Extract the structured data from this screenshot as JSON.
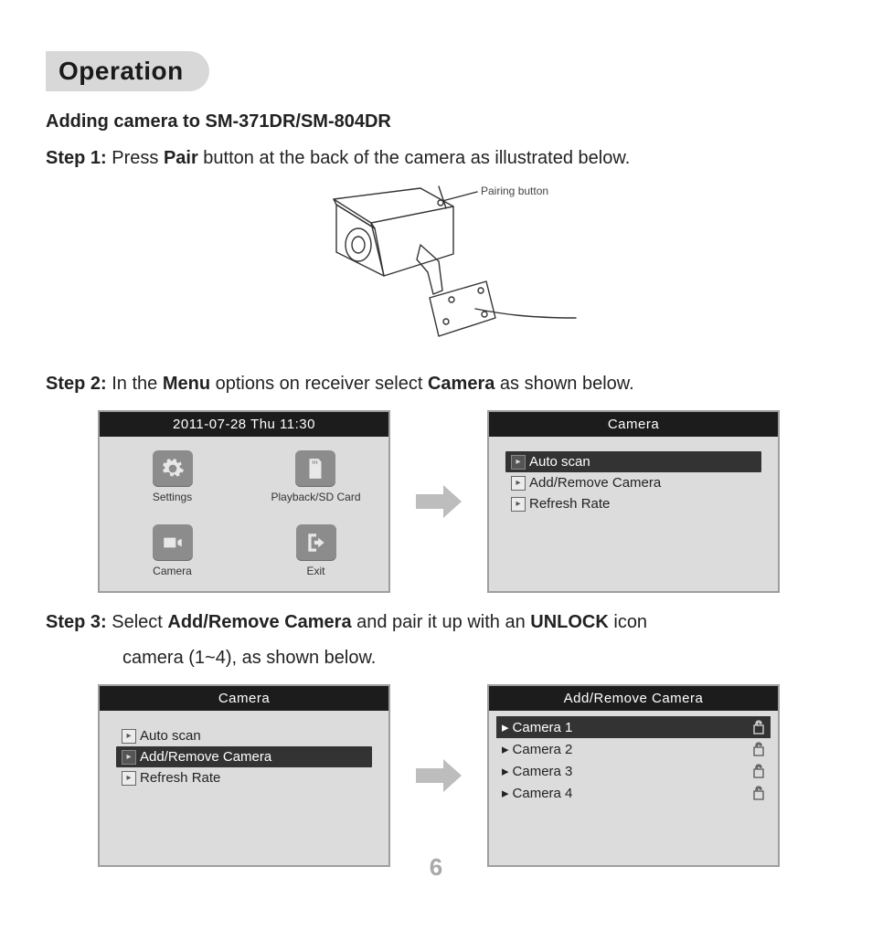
{
  "section_title": "Operation",
  "sub_heading": "Adding camera to SM-371DR/SM-804DR",
  "step1": {
    "label": "Step 1:",
    "pre": " Press ",
    "b1": "Pair",
    "post": " button at the back of the camera as illustrated below."
  },
  "cam_illustration": {
    "callout": "Pairing button"
  },
  "step2": {
    "label": "Step 2:",
    "pre": " In the ",
    "b1": "Menu",
    "mid": " options on receiver select ",
    "b2": "Camera",
    "post": " as shown below."
  },
  "screen_menu": {
    "header": "2011-07-28 Thu  11:30",
    "items": [
      {
        "label": "Settings",
        "icon": "gear"
      },
      {
        "label": "Playback/SD Card",
        "icon": "sd"
      },
      {
        "label": "Camera",
        "icon": "camera"
      },
      {
        "label": "Exit",
        "icon": "exit"
      }
    ]
  },
  "screen_camera_menu1": {
    "header": "Camera",
    "items": [
      {
        "label": "Auto scan",
        "selected": true
      },
      {
        "label": "Add/Remove  Camera",
        "selected": false
      },
      {
        "label": "Refresh Rate",
        "selected": false
      }
    ]
  },
  "step3": {
    "label": "Step 3:",
    "pre": " Select ",
    "b1": "Add/Remove Camera",
    "mid": " and pair it up with an ",
    "b2": "UNLOCK",
    "post": " icon",
    "line2": "camera (1~4), as shown below."
  },
  "screen_camera_menu2": {
    "header": "Camera",
    "items": [
      {
        "label": "Auto scan",
        "selected": false
      },
      {
        "label": "Add/Remove  Camera",
        "selected": true
      },
      {
        "label": "Refresh Rate",
        "selected": false
      }
    ]
  },
  "screen_add_remove": {
    "header": "Add/Remove Camera",
    "items": [
      {
        "label": "Camera 1",
        "selected": true,
        "lock": "unlock"
      },
      {
        "label": "Camera 2",
        "selected": false,
        "lock": "unlock"
      },
      {
        "label": "Camera 3",
        "selected": false,
        "lock": "unlock"
      },
      {
        "label": "Camera 4",
        "selected": false,
        "lock": "unlock"
      }
    ]
  },
  "page_number": "6"
}
